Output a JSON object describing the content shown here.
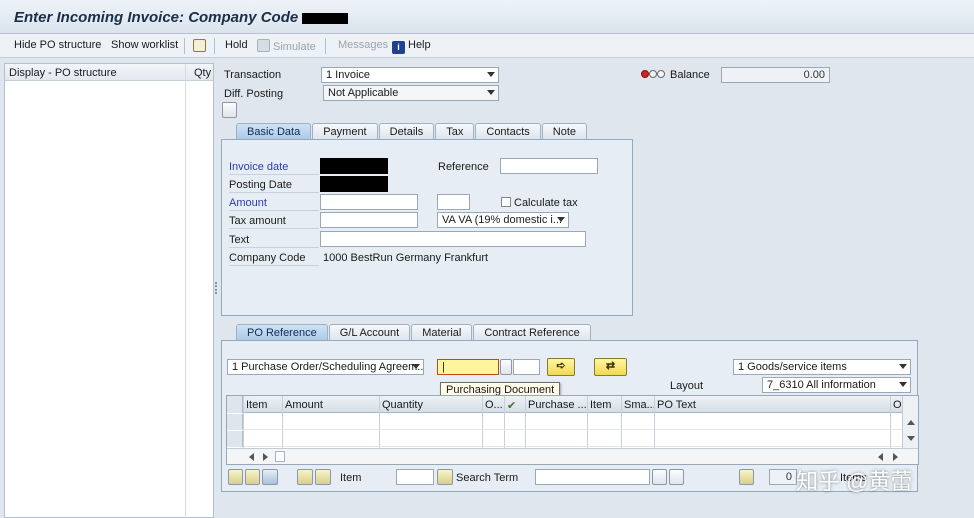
{
  "window": {
    "title": "Enter Incoming Invoice: Company Code"
  },
  "toolbar": {
    "hide_po_structure": "Hide PO structure",
    "show_worklist": "Show worklist",
    "hold": "Hold",
    "simulate": "Simulate",
    "messages": "Messages",
    "help": "Help"
  },
  "left_panel": {
    "col_display": "Display - PO structure",
    "col_qty": "Qty"
  },
  "header": {
    "transaction_label": "Transaction",
    "transaction_value": "1 Invoice",
    "diff_posting_label": "Diff. Posting",
    "diff_posting_value": "Not Applicable",
    "balance_label": "Balance",
    "balance_value": "0.00"
  },
  "basic_tabs": [
    "Basic Data",
    "Payment",
    "Details",
    "Tax",
    "Contacts",
    "Note"
  ],
  "basic_data": {
    "invoice_date_label": "Invoice date",
    "posting_date_label": "Posting Date",
    "reference_label": "Reference",
    "amount_label": "Amount",
    "calculate_tax_label": "Calculate tax",
    "tax_amount_label": "Tax amount",
    "tax_code_value": "VA VA (19% domestic i...",
    "text_label": "Text",
    "company_code_label": "Company Code",
    "company_code_value": "1000 BestRun Germany Frankfurt"
  },
  "po_tabs": [
    "PO Reference",
    "G/L Account",
    "Material",
    "Contract Reference"
  ],
  "po_reference": {
    "ref_type_value": "1 Purchase Order/Scheduling Agreem...",
    "po_input_value": "|",
    "tooltip": "Purchasing Document",
    "goods_service_value": "1 Goods/service items",
    "layout_label": "Layout",
    "layout_value": "7_6310 All information"
  },
  "grid": {
    "columns": [
      "Item",
      "Amount",
      "Quantity",
      "O...",
      "Purchase ...",
      "Item",
      "Sma...",
      "PO Text",
      "Ou"
    ]
  },
  "bottom_bar": {
    "item_label": "Item",
    "search_term_label": "Search Term",
    "items_count": "0",
    "items_label": "Items"
  },
  "watermark": "知乎 @黄蕾",
  "colors": {
    "accent": "#a9c8e6",
    "title": "#1b2e49",
    "required_label": "#2a3ea8",
    "highlight": "#fff59a"
  }
}
